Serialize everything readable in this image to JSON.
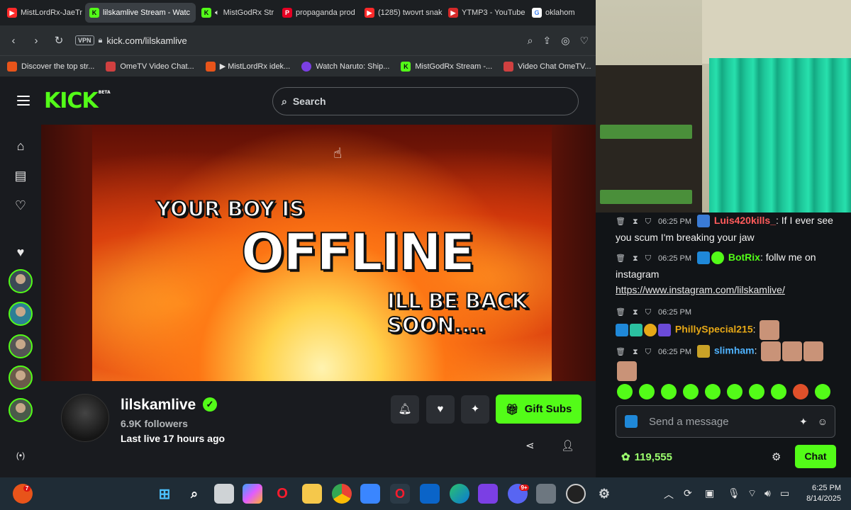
{
  "browser": {
    "tabs": [
      {
        "label": "MistLordRx-JaeTr",
        "icon": "youtube-icon",
        "color": "#ff2a2a"
      },
      {
        "label": "lilskamlive Stream - Watc",
        "icon": "kick-icon",
        "color": "#53fc18",
        "active": true
      },
      {
        "label": "MistGodRx Str",
        "icon": "kick-icon",
        "color": "#53fc18"
      },
      {
        "label": "propaganda prod",
        "icon": "pinterest-icon",
        "color": "#e60023"
      },
      {
        "label": "(1285) twovrt snak",
        "icon": "youtube-icon",
        "color": "#ff2a2a"
      },
      {
        "label": "YTMP3 - YouTube",
        "icon": "ytmp3-icon",
        "color": "#d62a2a"
      },
      {
        "label": "oklahom",
        "icon": "google-icon",
        "color": "#4285f4"
      }
    ],
    "address": {
      "vpn_label": "VPN",
      "url": "kick.com/lilskamlive"
    },
    "bookmarks": [
      {
        "label": "Discover the top str...",
        "color": "#e8541a"
      },
      {
        "label": "OmeTV Video Chat...",
        "color": "#d04040"
      },
      {
        "label": "▶ MistLordRx idek...",
        "color": "#e8541a"
      },
      {
        "label": "Watch Naruto: Ship...",
        "color": "#7b3fe4"
      },
      {
        "label": "MistGodRx Stream -...",
        "color": "#53fc18"
      },
      {
        "label": "Video Chat OmeTV...",
        "color": "#d04040"
      }
    ]
  },
  "kick": {
    "logo_text": "KICK",
    "logo_badge": "BETA",
    "search_placeholder": "Search"
  },
  "player": {
    "line1": "YOUR BOY IS",
    "line2": "OFFLINE",
    "line3": "ILL BE BACK SOON...."
  },
  "channel": {
    "name": "lilskamlive",
    "followers": "6.9K followers",
    "last_live": "Last live 17 hours ago",
    "gift_label": "Gift Subs"
  },
  "chat": {
    "messages": [
      {
        "time": "06:25 PM",
        "user": "Luis420kills_",
        "user_color": "#ff5b5b",
        "text": ": If I ever see you scum I'm breaking your jaw"
      },
      {
        "time": "06:25 PM",
        "user": "BotRix",
        "user_color": "#53fc18",
        "text": ": follw me on instagram",
        "link": "https://www.instagram.com/lilskamlive/"
      },
      {
        "time": "06:25 PM",
        "user": "PhillySpecial215",
        "user_color": "#e6a817",
        "text": ":"
      },
      {
        "time": "06:25 PM",
        "user": "slimham",
        "user_color": "#4fb3ff",
        "text": ":"
      }
    ],
    "input_placeholder": "Send a message",
    "points": "119,555",
    "send_label": "Chat"
  },
  "taskbar": {
    "time": "6:25 PM",
    "date": "8/14/2025",
    "opera_badge": "7",
    "discord_badge": "9+"
  }
}
